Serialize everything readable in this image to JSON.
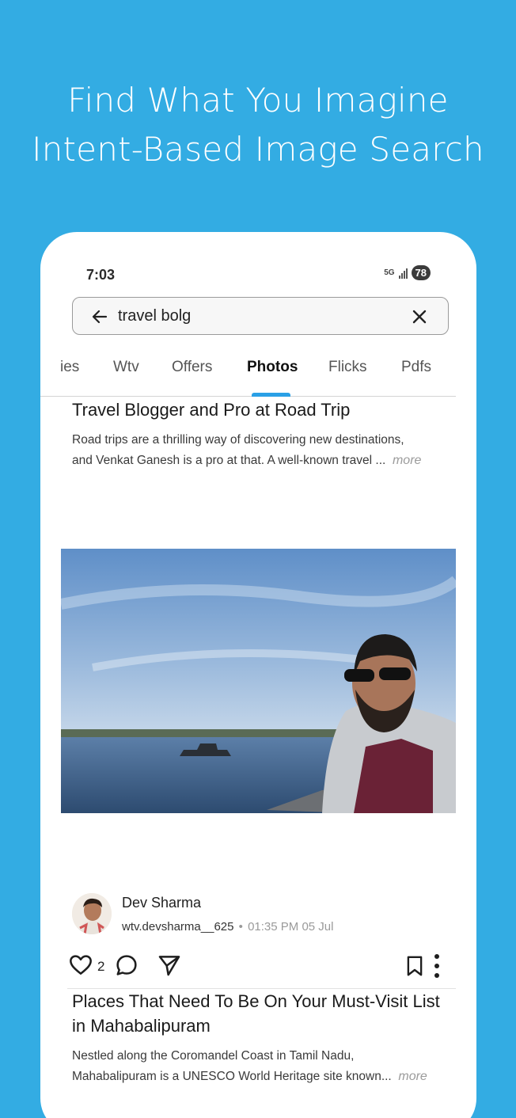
{
  "hero": {
    "line1": "Find What You Imagine",
    "line2": "Intent-Based Image Search"
  },
  "status_bar": {
    "time": "7:03",
    "network": "5G",
    "battery": "78"
  },
  "search": {
    "query": "travel bolg"
  },
  "tabs": [
    {
      "label": "ies",
      "active": false
    },
    {
      "label": "Wtv",
      "active": false
    },
    {
      "label": "Offers",
      "active": false
    },
    {
      "label": "Photos",
      "active": true
    },
    {
      "label": "Flicks",
      "active": false
    },
    {
      "label": "Pdfs",
      "active": false
    }
  ],
  "post_top": {
    "title": "Travel Blogger and Pro at Road Trip",
    "excerpt_line1": "Road trips are a thrilling way of discovering new destinations,",
    "excerpt_line2": "and Venkat Ganesh is a pro at that. A well-known travel ...",
    "more_label": "more"
  },
  "author": {
    "name": "Dev Sharma",
    "handle": "wtv.devsharma__625",
    "separator": "•",
    "timestamp": "01:35 PM 05 Jul"
  },
  "actions": {
    "like_count": "2"
  },
  "post_bottom": {
    "title_line1": "Places That Need To Be On Your Must-Visit List",
    "title_line2": "in Mahabalipuram",
    "excerpt_line1": "Nestled along the Coromandel Coast in Tamil Nadu,",
    "excerpt_line2": "Mahabalipuram is a UNESCO World Heritage site known...",
    "more_label": "more"
  },
  "colors": {
    "background": "#33ace3",
    "tab_indicator": "#2aa0e6"
  }
}
